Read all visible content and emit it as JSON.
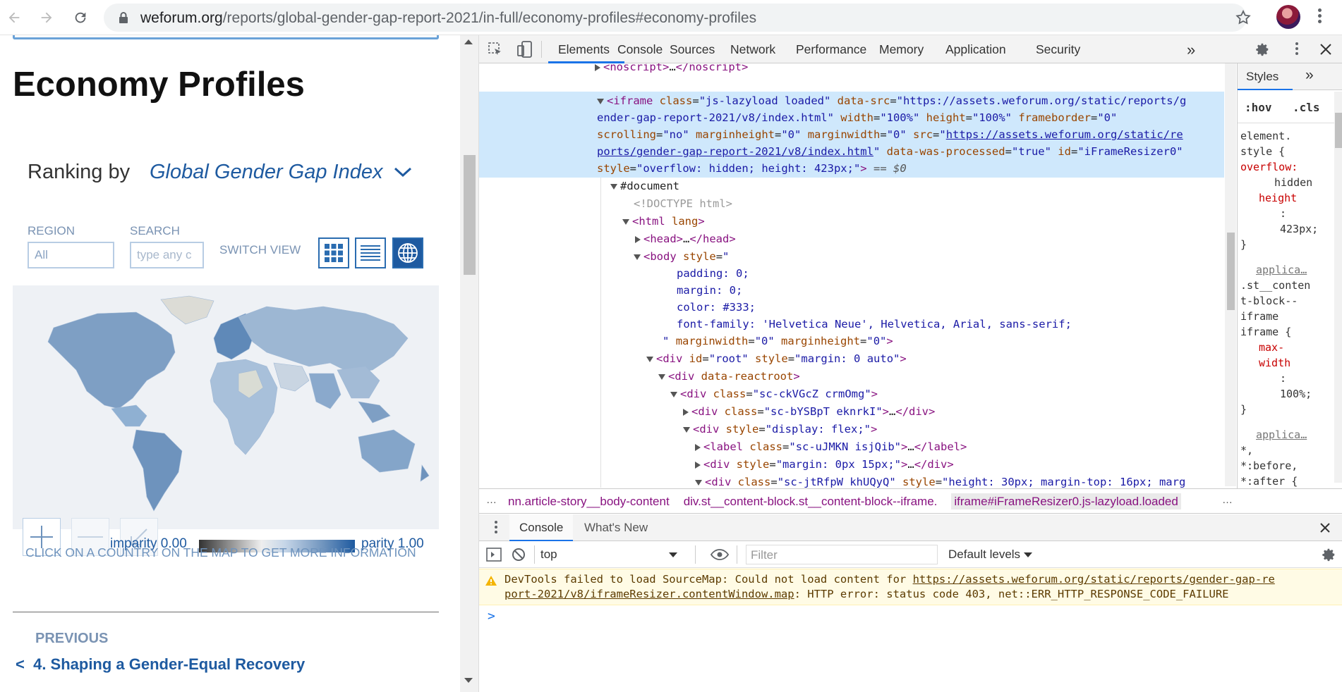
{
  "browser": {
    "url_host": "weforum.org",
    "url_path": "/reports/global-gender-gap-report-2021/in-full/economy-profiles#economy-profiles"
  },
  "page": {
    "title": "Economy Profiles",
    "ranking_prefix": "Ranking by",
    "ranking_value": "Global Gender Gap Index",
    "region_label": "REGION",
    "region_value": "All",
    "search_label": "SEARCH",
    "search_placeholder": "type any c",
    "switch_view_label": "SWITCH VIEW",
    "legend_left": "imparity 0.00",
    "legend_right": "parity 1.00",
    "map_hint": "CLICK ON A COUNTRY ON THE MAP TO GET MORE INFORMATION",
    "previous_label": "PREVIOUS",
    "previous_link": "4. Shaping a Gender-Equal Recovery"
  },
  "devtools": {
    "tabs": [
      "Elements",
      "Console",
      "Sources",
      "Network",
      "Performance",
      "Memory",
      "Application",
      "Security"
    ],
    "more_tabs": "»",
    "dom_lines": [
      {
        "indent": 0,
        "tri": "right",
        "html": "&lt;noscript&gt;…&lt;/noscript&gt;"
      }
    ],
    "breadcrumbs": [
      "nn.article-story__body-content",
      "div.st__content-block.st__content-block--iframe.",
      "iframe#iFrameResizer0.js-lazyload.loaded"
    ],
    "styles_tab": "Styles",
    "styles_more": "»",
    "hov": ":hov",
    "cls": ".cls",
    "styles": [
      "element.",
      "style {",
      "overflow:",
      "hidden",
      "height",
      ":",
      "423px;",
      "}",
      "applica…",
      ".st__conten",
      "t-block--",
      "iframe",
      "iframe {",
      "max-",
      "width",
      ":",
      "100%;",
      "}",
      "applica…",
      "*,",
      "*:before,",
      "*:after {"
    ],
    "drawer_tabs": [
      "Console",
      "What's New"
    ],
    "context": "top",
    "filter_placeholder": "Filter",
    "levels": "Default levels",
    "warning_line1": "DevTools failed to load SourceMap: Could not load content for ",
    "warning_link1": "https://assets.weforum.org/static/reports/gender-gap-re",
    "warning_link2": "port-2021/v8/iframeResizer.contentWindow.map",
    "warning_tail": ": HTTP error: status code 403, net::ERR_HTTP_RESPONSE_CODE_FAILURE",
    "prompt": ">"
  },
  "colors": {
    "accent": "#1a73e8",
    "weforum_blue": "#1e5aa0",
    "selected_row": "#cfe8fc",
    "warning_bg": "#fffbe5"
  }
}
